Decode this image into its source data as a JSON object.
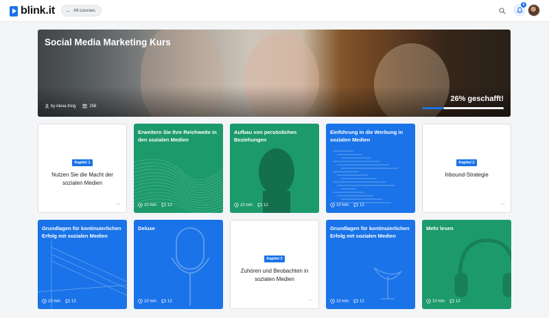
{
  "app": {
    "logo_text": "blink.it"
  },
  "header": {
    "back_label": "All courses",
    "notification_count": "2",
    "icons": {
      "back": "arrow-left-icon",
      "search": "search-icon",
      "bell": "bell-icon"
    }
  },
  "hero": {
    "title": "Social Media Marketing Kurs",
    "author": "by Alexa King",
    "participants": "258",
    "progress_text": "26% geschafft!",
    "progress_fraction": 0.26,
    "colors": {
      "accent": "#1a73e8"
    }
  },
  "cards": [
    {
      "variant": "white",
      "badge": "Kapitel 1",
      "title": "Nutzen Sie die Macht der sozialen Medien"
    },
    {
      "variant": "green",
      "title": "Erweitern Sie Ihre Reichweite in den sozialen Medien",
      "duration": "10 min",
      "comments": "12",
      "art": "waves"
    },
    {
      "variant": "green",
      "title": "Aufbau von persönlichen Beziehungen",
      "duration": "10 min",
      "comments": "12",
      "art": "portrait"
    },
    {
      "variant": "blue",
      "title": "Einführung in die Werbung in sozialen Medien",
      "duration": "10 min",
      "comments": "12",
      "art": "code"
    },
    {
      "variant": "white",
      "badge": "Kapitel 2",
      "title": "Inbound-Strategie"
    },
    {
      "variant": "blue",
      "title": "Grundlagen für kontinuierlichen Erfolg mit sozialen Medien",
      "duration": "10 min",
      "comments": "12",
      "art": "bridge"
    },
    {
      "variant": "blue",
      "title": "Deluxe",
      "duration": "10 min",
      "comments": "12",
      "art": "microphone"
    },
    {
      "variant": "white",
      "badge": "Kapitel 3",
      "title": "Zuhören und Beobachten in sozialen Medien"
    },
    {
      "variant": "blue",
      "title": "Grundlagen für kontinuierlichen Erfolg mit sozialen Medien",
      "duration": "10 min",
      "comments": "12",
      "art": "satellite"
    },
    {
      "variant": "green",
      "title": "Mehr lesen",
      "duration": "10 min",
      "comments": "12",
      "art": "headphones"
    }
  ]
}
